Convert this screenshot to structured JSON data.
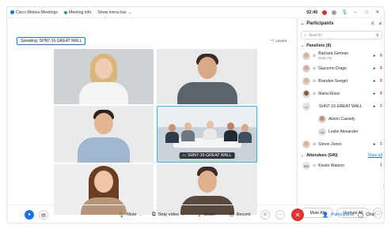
{
  "titlebar": {
    "app_name": "Cisco Webex Meetings",
    "meeting_info": "Meeting info",
    "show_menu_bar": "Show menu bar",
    "timer": "02:40"
  },
  "stage": {
    "speaking_label": "Speaking: SHN7-16-GREAT WALL",
    "layout_label": "Layout",
    "room_label": "SHN7-16-GREAT WALL"
  },
  "panel": {
    "title": "Participants",
    "search_placeholder": "Search",
    "panelists_header": "Panelists (6)",
    "panelists": [
      {
        "name": "Barbara German",
        "sub": "Host, me",
        "mic": "muted"
      },
      {
        "name": "Giacomo Drago",
        "sub": "",
        "mic": "muted"
      },
      {
        "name": "Brandon Seeger",
        "sub": "",
        "mic": "muted"
      },
      {
        "name": "Maria Rossi",
        "sub": "",
        "mic": "muted"
      },
      {
        "name": "SHN7-16-GREAT WALL",
        "sub": "",
        "mic": "active"
      }
    ],
    "room_members": [
      {
        "name": "Alison Cassidy"
      },
      {
        "name": "Leslie Alexander",
        "initials": "LA"
      }
    ],
    "panelist_last": {
      "name": "Simon Jones",
      "mic": "active"
    },
    "attendees_header": "Attendees (540)",
    "view_all": "View all",
    "attendees": [
      {
        "name": "Kristin Watson",
        "initials": "KW",
        "mic": "active"
      }
    ],
    "mute_all": "Mute All",
    "unmute_all": "Unmute All"
  },
  "controls": {
    "mute": "Mute",
    "stop_video": "Stop video",
    "share": "Share",
    "record": "Record",
    "participants": "Participants",
    "chat": "Chat"
  }
}
